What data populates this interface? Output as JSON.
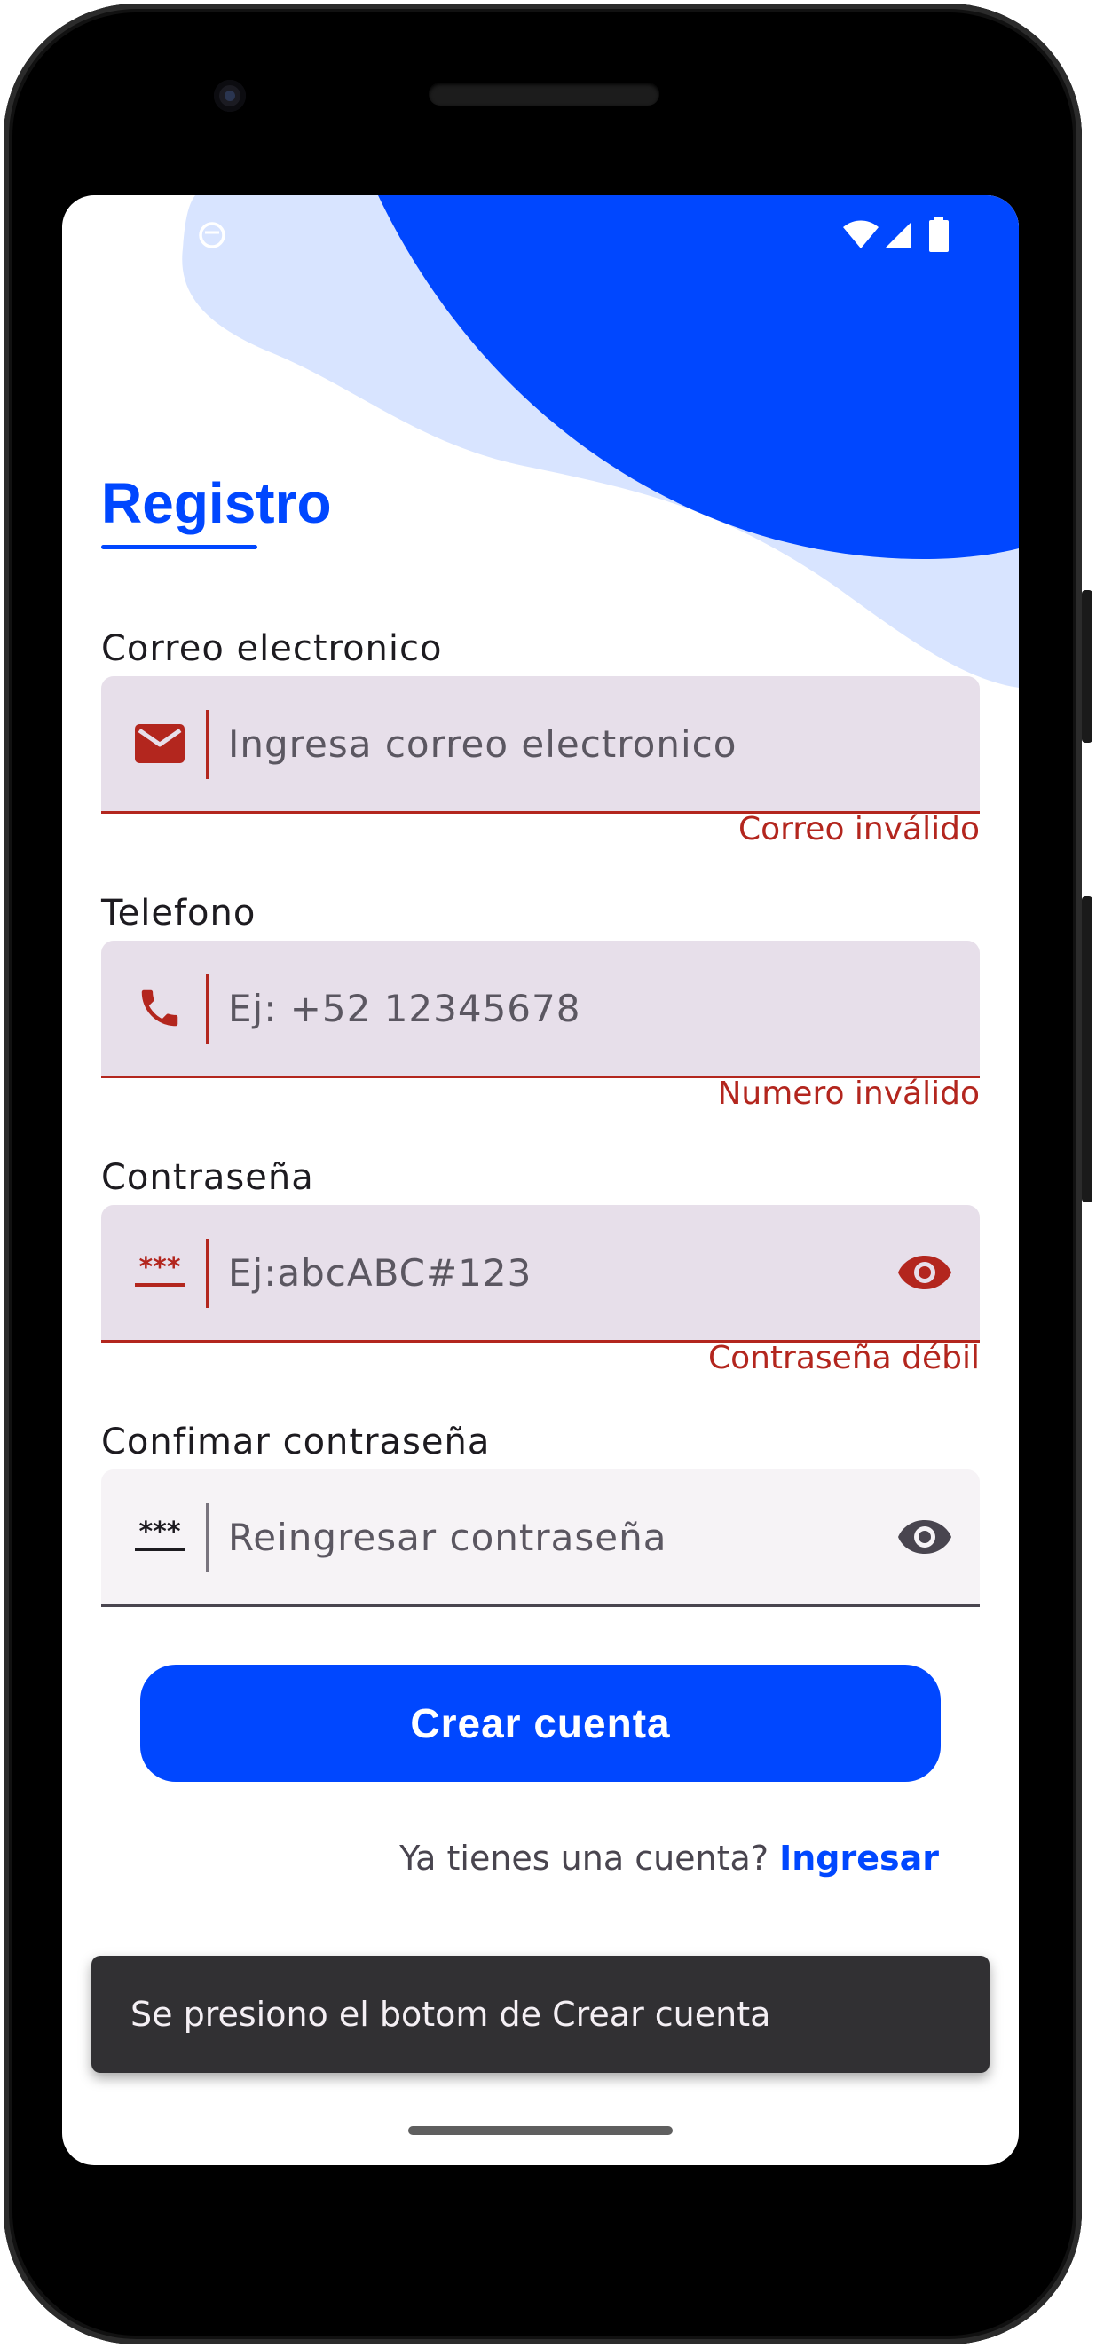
{
  "screen": {
    "title": "Registro",
    "email": {
      "label": "Correo electronico",
      "placeholder": "Ingresa correo electronico",
      "error": "Correo inválido",
      "icon": "mail-icon"
    },
    "phone": {
      "label": "Telefono",
      "placeholder": "Ej: +52 12345678",
      "error": "Numero inválido",
      "icon": "phone-icon"
    },
    "password": {
      "label": "Contraseña",
      "placeholder": "Ej:abcABC#123",
      "error": "Contraseña débil",
      "icon": "password-icon"
    },
    "confirm_password": {
      "label": "Confimar contraseña",
      "placeholder": "Reingresar contraseña",
      "icon": "password-icon"
    },
    "create_button": "Crear cuenta",
    "login_prompt": "Ya tienes una cuenta?",
    "login_link": "Ingresar",
    "snackbar": "Se presiono el botom de Crear cuenta"
  },
  "colors": {
    "primary": "#0047ff",
    "error": "#b3261e",
    "field_error_bg": "#e7dfea",
    "field_bg": "#f6f3f6",
    "snackbar_bg": "#313033"
  }
}
